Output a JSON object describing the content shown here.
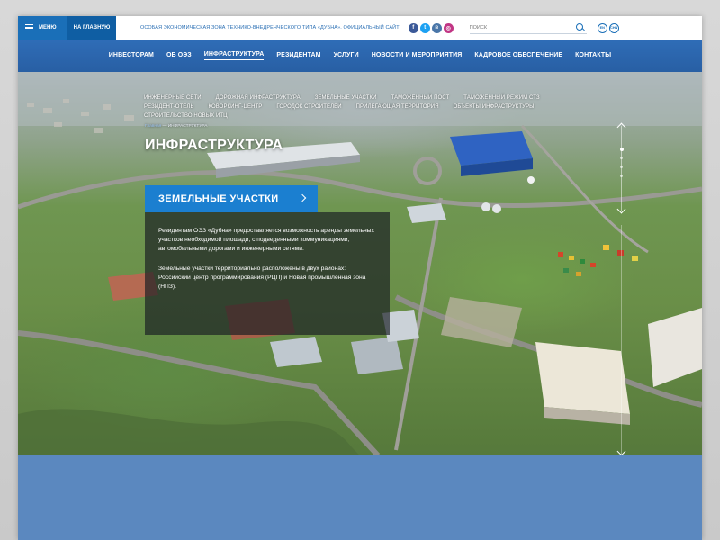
{
  "topbar": {
    "menu_label": "МЕНЮ",
    "home_label": "НА ГЛАВНУЮ",
    "tagline": "ОСОБАЯ ЭКОНОМИЧЕСКАЯ ЗОНА ТЕХНИКО-ВНЕДРЕНЧЕСКОГО ТИПА «ДУБНА». ОФИЦИАЛЬНЫЙ САЙТ",
    "socials": [
      {
        "name": "facebook-icon",
        "glyph": "f",
        "color": "#3b5998"
      },
      {
        "name": "twitter-icon",
        "glyph": "t",
        "color": "#1da1f2"
      },
      {
        "name": "vk-icon",
        "glyph": "в",
        "color": "#4a76a8"
      },
      {
        "name": "instagram-icon",
        "glyph": "◎",
        "color": "#c13584"
      }
    ],
    "search_placeholder": "ПОИСК",
    "langs": [
      "EN",
      "CHN"
    ]
  },
  "mainnav": {
    "items": [
      {
        "label": "ИНВЕСТОРАМ",
        "active": false
      },
      {
        "label": "ОБ ОЭЗ",
        "active": false
      },
      {
        "label": "ИНФРАСТРУКТУРА",
        "active": true
      },
      {
        "label": "РЕЗИДЕНТАМ",
        "active": false
      },
      {
        "label": "УСЛУГИ",
        "active": false
      },
      {
        "label": "НОВОСТИ И МЕРОПРИЯТИЯ",
        "active": false
      },
      {
        "label": "КАДРОВОЕ ОБЕСПЕЧЕНИЕ",
        "active": false
      },
      {
        "label": "КОНТАКТЫ",
        "active": false
      }
    ]
  },
  "subnav": {
    "items": [
      "ИНЖЕНЕРНЫЕ СЕТИ",
      "ДОРОЖНАЯ ИНФРАСТРУКТУРА",
      "ЗЕМЕЛЬНЫЕ УЧАСТКИ",
      "ТАМОЖЕННЫЙ ПОСТ",
      "ТАМОЖЕННЫЙ РЕЖИМ СТЗ",
      "РЕЗИДЕНТ-ОТЕЛЬ",
      "КОВОРКИНГ-ЦЕНТР",
      "ГОРОДОК СТРОИТЕЛЕЙ",
      "ПРИЛЕГАЮЩАЯ ТЕРРИТОРИЯ",
      "ОБЪЕКТЫ ИНФРАСТРУКТУРЫ",
      "СТРОИТЕЛЬСТВО НОВЫХ ИТЦ"
    ]
  },
  "breadcrumb": {
    "home": "Главная",
    "separator": " — ",
    "current": "ИНФРАСТРУКТУРА"
  },
  "page": {
    "title": "ИНФРАСТРУКТУРА",
    "button_label": "ЗЕМЕЛЬНЫЕ УЧАСТКИ",
    "paragraphs": [
      "Резидентам ОЭЗ «Дубна» предоставляется возможность аренды земельных участков необходимой площади, с подведенными коммуникациями, автомобильными дорогами и инженерными сетями.",
      "Земельные участки территориально расположены в двух районах: Российский центр программирования (РЦП) и Новая промышленная зона (НПЗ)."
    ]
  },
  "slider": {
    "dots": 4,
    "active_index": 0
  },
  "colors": {
    "brand_blue": "#1a6fb8",
    "nav_blue": "#2f6db7",
    "button_blue": "#1b7fd0"
  }
}
